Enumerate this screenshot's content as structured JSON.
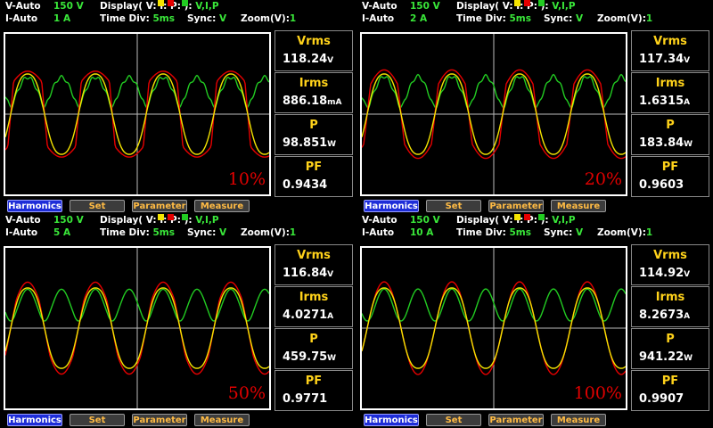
{
  "colors": {
    "voltage": "#f5e400",
    "current": "#e60000",
    "power": "#22cc22",
    "accent": "#1e2dd8"
  },
  "panels": [
    {
      "v_mode": "V-Auto",
      "v_range": "150",
      "v_unit": "V",
      "i_mode": "I-Auto",
      "i_range": "1",
      "i_unit": "A",
      "display_label": "Display( V:",
      "display_i": "I:",
      "display_p": "P:",
      "display_end": "):",
      "display_val": "V,I,P",
      "timediv_label": "Time  Div:",
      "timediv_val": "5ms",
      "sync_label": "Sync:",
      "sync_val": "V",
      "zoom_label": "Zoom(V):",
      "zoom_val": "1",
      "load_pct": "10%",
      "distortion": 0.7,
      "vrms_label": "Vrms",
      "vrms_val": "118.24",
      "vrms_unit": "V",
      "irms_label": "Irms",
      "irms_val": "886.18",
      "irms_unit": "mA",
      "p_label": "P",
      "p_val": "98.851",
      "p_unit": "W",
      "pf_label": "PF",
      "pf_val": "0.9434",
      "buttons": [
        "Harmonics",
        "Set",
        "Parameter",
        "Measure"
      ]
    },
    {
      "v_mode": "V-Auto",
      "v_range": "150",
      "v_unit": "V",
      "i_mode": "I-Auto",
      "i_range": "2",
      "i_unit": "A",
      "display_label": "Display( V:",
      "display_i": "I:",
      "display_p": "P:",
      "display_end": "):",
      "display_val": "V,I,P",
      "timediv_label": "Time  Div:",
      "timediv_val": "5ms",
      "sync_label": "Sync:",
      "sync_val": "V",
      "zoom_label": "Zoom(V):",
      "zoom_val": "1",
      "load_pct": "20%",
      "distortion": 0.55,
      "vrms_label": "Vrms",
      "vrms_val": "117.34",
      "vrms_unit": "V",
      "irms_label": "Irms",
      "irms_val": "1.6315",
      "irms_unit": "A",
      "p_label": "P",
      "p_val": "183.84",
      "p_unit": "W",
      "pf_label": "PF",
      "pf_val": "0.9603",
      "buttons": [
        "Harmonics",
        "Set",
        "Parameter",
        "Measure"
      ]
    },
    {
      "v_mode": "V-Auto",
      "v_range": "150",
      "v_unit": "V",
      "i_mode": "I-Auto",
      "i_range": "5",
      "i_unit": "A",
      "display_label": "Display( V:",
      "display_i": "I:",
      "display_p": "P:",
      "display_end": "):",
      "display_val": "V,I,P",
      "timediv_label": "Time  Div:",
      "timediv_val": "5ms",
      "sync_label": "Sync:",
      "sync_val": "V",
      "zoom_label": "Zoom(V):",
      "zoom_val": "1",
      "load_pct": "50%",
      "distortion": 0.25,
      "vrms_label": "Vrms",
      "vrms_val": "116.84",
      "vrms_unit": "V",
      "irms_label": "Irms",
      "irms_val": "4.0271",
      "irms_unit": "A",
      "p_label": "P",
      "p_val": "459.75",
      "p_unit": "W",
      "pf_label": "PF",
      "pf_val": "0.9771",
      "buttons": [
        "Harmonics",
        "Set",
        "Parameter",
        "Measure"
      ]
    },
    {
      "v_mode": "V-Auto",
      "v_range": "150",
      "v_unit": "V",
      "i_mode": "I-Auto",
      "i_range": "10",
      "i_unit": "A",
      "display_label": "Display( V:",
      "display_i": "I:",
      "display_p": "P:",
      "display_end": "):",
      "display_val": "V,I,P",
      "timediv_label": "Time  Div:",
      "timediv_val": "5ms",
      "sync_label": "Sync:",
      "sync_val": "V",
      "zoom_label": "Zoom(V):",
      "zoom_val": "1",
      "load_pct": "100%",
      "distortion": 0.1,
      "vrms_label": "Vrms",
      "vrms_val": "114.92",
      "vrms_unit": "V",
      "irms_label": "Irms",
      "irms_val": "8.2673",
      "irms_unit": "A",
      "p_label": "P",
      "p_val": "941.22",
      "p_unit": "W",
      "pf_label": "PF",
      "pf_val": "0.9907",
      "buttons": [
        "Harmonics",
        "Set",
        "Parameter",
        "Measure"
      ]
    }
  ]
}
